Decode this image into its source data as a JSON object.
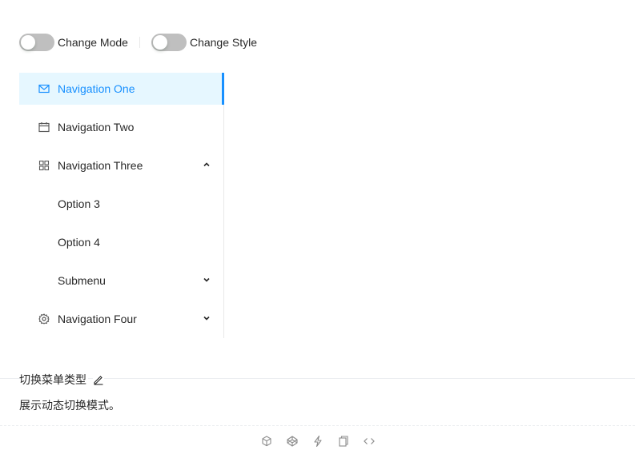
{
  "toggles": [
    {
      "label": "Change Mode",
      "checked": false
    },
    {
      "label": "Change Style",
      "checked": false
    }
  ],
  "menu": {
    "items": [
      {
        "label": "Navigation One",
        "icon": "mail-icon",
        "selected": true
      },
      {
        "label": "Navigation Two",
        "icon": "calendar-icon",
        "selected": false
      },
      {
        "label": "Navigation Three",
        "icon": "appstore-icon",
        "expanded": true,
        "children": [
          {
            "label": "Option 3"
          },
          {
            "label": "Option 4"
          },
          {
            "label": "Submenu",
            "expanded": false
          }
        ]
      },
      {
        "label": "Navigation Four",
        "icon": "setting-icon",
        "expanded": false
      }
    ]
  },
  "demo": {
    "title": "切换菜单类型",
    "description": "展示动态切换模式。"
  },
  "actions": [
    "codesandbox-icon",
    "codepen-icon",
    "thunderbolt-icon",
    "copy-icon",
    "code-icon"
  ],
  "colors": {
    "primary": "#1890ff",
    "selected_bg": "#e6f7ff",
    "switch_off": "#bfbfbf"
  }
}
